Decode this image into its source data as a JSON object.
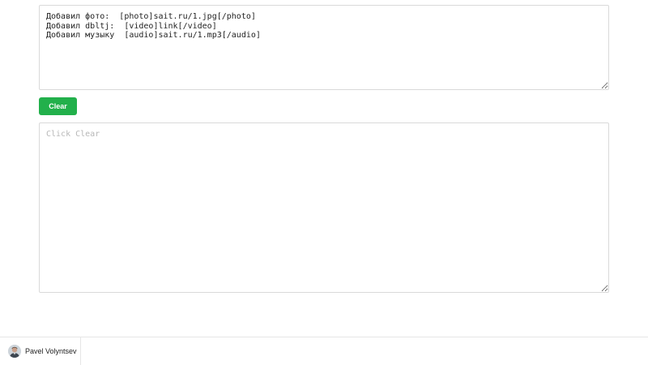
{
  "editor": {
    "input_value": "Добавил фото:  [photo]sait.ru/1.jpg[/photo]\nДобавил dbltj:  [video]link[/video]\nДобавил музыку  [audio]sait.ru/1.mp3[/audio]",
    "clear_label": "Clear",
    "output_placeholder": "Click Clear",
    "output_value": ""
  },
  "footer": {
    "author_name": "Pavel Volyntsev"
  },
  "colors": {
    "clear_button": "#22b04b"
  }
}
